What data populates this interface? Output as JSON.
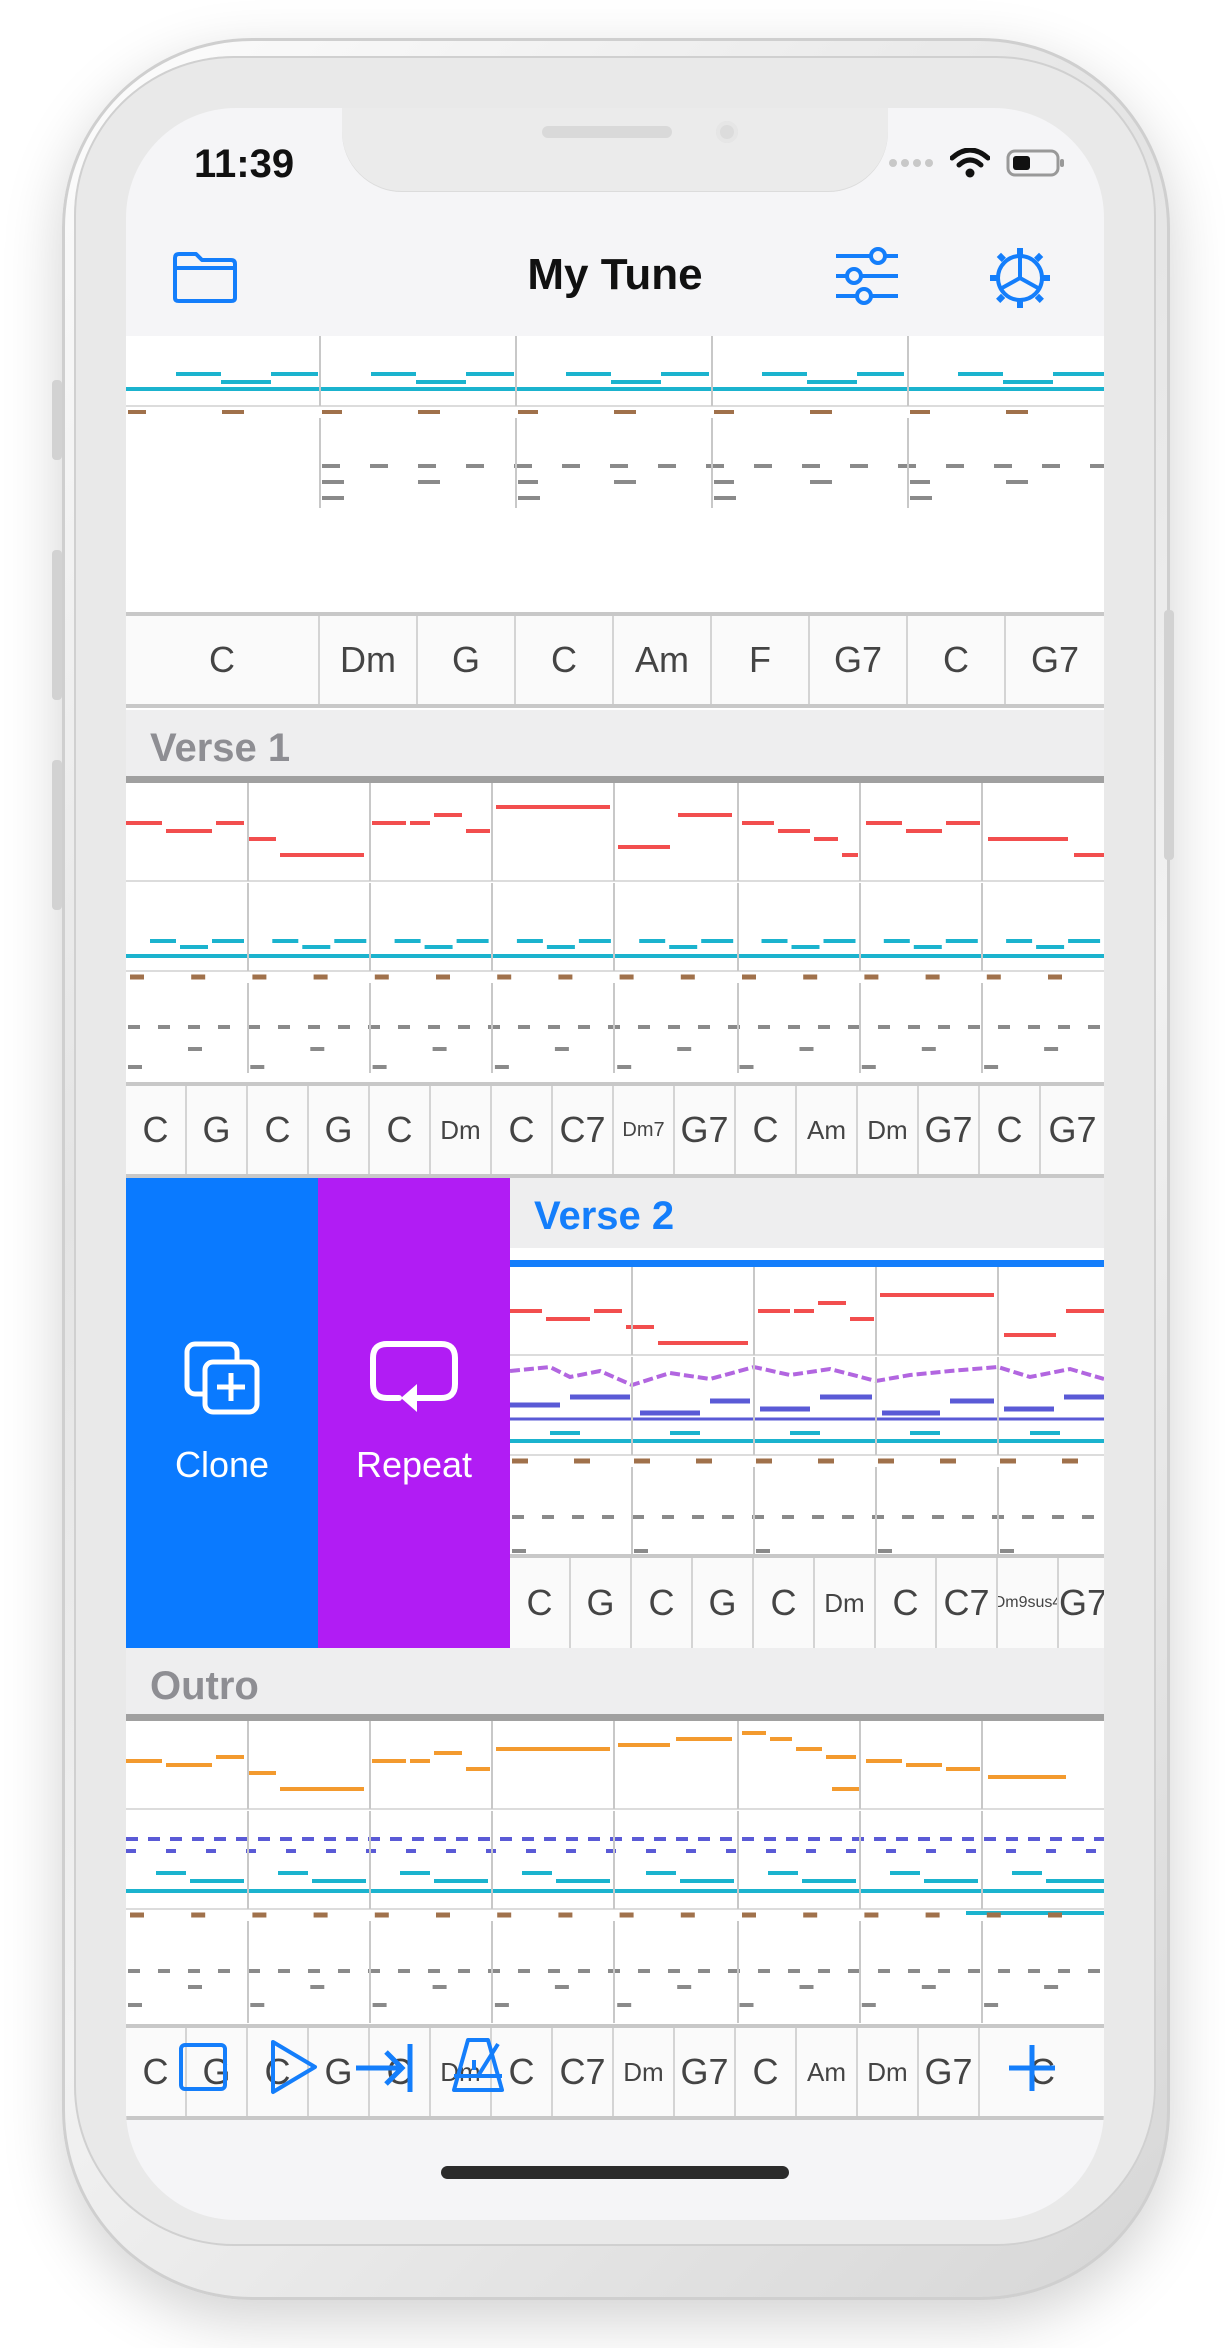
{
  "status": {
    "time": "11:39"
  },
  "nav": {
    "title": "My Tune",
    "icons": {
      "left": "folder-icon",
      "mixer": "sliders-icon",
      "settings": "gear-icon"
    }
  },
  "colors": {
    "accent": "#147EFB",
    "clone": "#0A7AFF",
    "repeat": "#B11CF4",
    "melody": "#F24E4E",
    "harmony": "#1BB3CE",
    "bass": "#A0714B",
    "drums": "#8A8A8A",
    "outro_melody": "#F39A2E",
    "purple_track": "#B266E0",
    "indigo_track": "#5A5AD6"
  },
  "sections": {
    "intro": {
      "chords": [
        "C",
        "Dm",
        "G",
        "C",
        "Am",
        "F",
        "G7",
        "C",
        "G7"
      ]
    },
    "verse1": {
      "title": "Verse 1",
      "chords": [
        "C",
        "G",
        "C",
        "G",
        "C",
        "Dm",
        "C",
        "C7",
        "Dm7",
        "G7",
        "C",
        "Am",
        "Dm",
        "G7",
        "C",
        "G7"
      ]
    },
    "verse2": {
      "title": "Verse 2",
      "chords": [
        "C",
        "G",
        "C",
        "G",
        "C",
        "Dm",
        "C",
        "C7",
        "Dm9sus4",
        "G7"
      ]
    },
    "outro": {
      "title": "Outro",
      "chords": [
        "C",
        "G",
        "C",
        "G",
        "C",
        "Dm",
        "C",
        "C7",
        "Dm",
        "G7",
        "C",
        "Am",
        "Dm",
        "G7",
        "C"
      ]
    }
  },
  "swipe_actions": {
    "clone": {
      "label": "Clone",
      "icon": "clone-icon"
    },
    "repeat": {
      "label": "Repeat",
      "icon": "repeat-icon"
    }
  },
  "toolbar": {
    "icons": [
      "stop-icon",
      "play-icon",
      "skip-to-end-icon",
      "metronome-icon",
      "add-icon"
    ]
  }
}
